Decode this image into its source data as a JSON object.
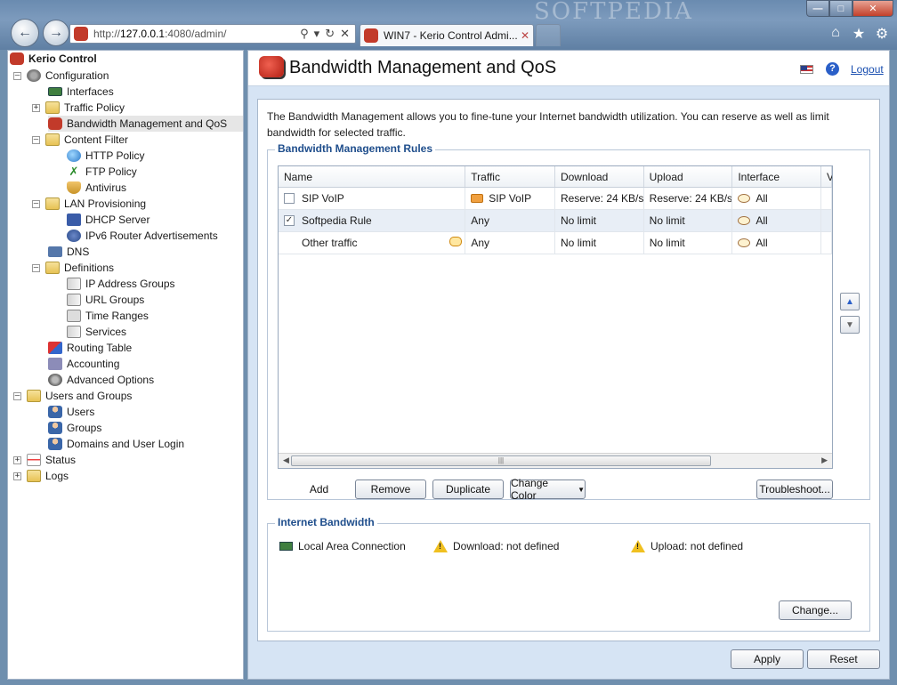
{
  "browser": {
    "url_prefix": "http://",
    "url_host": "127.0.0.1",
    "url_rest": ":4080/admin/",
    "tab_title": "WIN7 - Kerio Control Admi...",
    "watermark": "SOFTPEDIA"
  },
  "sidebar": {
    "root": "Kerio Control",
    "items": [
      {
        "label": "Configuration"
      },
      {
        "label": "Interfaces"
      },
      {
        "label": "Traffic Policy"
      },
      {
        "label": "Bandwidth Management and QoS"
      },
      {
        "label": "Content Filter"
      },
      {
        "label": "HTTP Policy"
      },
      {
        "label": "FTP Policy"
      },
      {
        "label": "Antivirus"
      },
      {
        "label": "LAN Provisioning"
      },
      {
        "label": "DHCP Server"
      },
      {
        "label": "IPv6 Router Advertisements"
      },
      {
        "label": "DNS"
      },
      {
        "label": "Definitions"
      },
      {
        "label": "IP Address Groups"
      },
      {
        "label": "URL Groups"
      },
      {
        "label": "Time Ranges"
      },
      {
        "label": "Services"
      },
      {
        "label": "Routing Table"
      },
      {
        "label": "Accounting"
      },
      {
        "label": "Advanced Options"
      },
      {
        "label": "Users and Groups"
      },
      {
        "label": "Users"
      },
      {
        "label": "Groups"
      },
      {
        "label": "Domains and User Login"
      },
      {
        "label": "Status"
      },
      {
        "label": "Logs"
      }
    ]
  },
  "header": {
    "title": "Bandwidth Management and QoS",
    "logout": "Logout"
  },
  "intro": "The Bandwidth Management allows you to fine-tune your Internet bandwidth utilization. You can reserve as well as limit bandwidth for selected traffic.",
  "rules": {
    "legend": "Bandwidth Management Rules",
    "columns": [
      "Name",
      "Traffic",
      "Download",
      "Upload",
      "Interface",
      "V"
    ],
    "rows": [
      {
        "name": "SIP VoIP",
        "checked": false,
        "traffic": "SIP VoIP",
        "download": "Reserve: 24 KB/s",
        "upload": "Reserve: 24 KB/s",
        "interface": "All"
      },
      {
        "name": "Softpedia Rule",
        "checked": true,
        "traffic": "Any",
        "download": "No limit",
        "upload": "No limit",
        "interface": "All"
      },
      {
        "name": "Other traffic",
        "checked": null,
        "traffic": "Any",
        "download": "No limit",
        "upload": "No limit",
        "interface": "All"
      }
    ],
    "buttons": {
      "add": "Add",
      "remove": "Remove",
      "duplicate": "Duplicate",
      "change_color": "Change Color",
      "troubleshoot": "Troubleshoot..."
    }
  },
  "internet": {
    "legend": "Internet Bandwidth",
    "connection": "Local Area Connection",
    "download": "Download: not defined",
    "upload": "Upload: not defined",
    "change": "Change..."
  },
  "footer": {
    "apply": "Apply",
    "reset": "Reset"
  }
}
